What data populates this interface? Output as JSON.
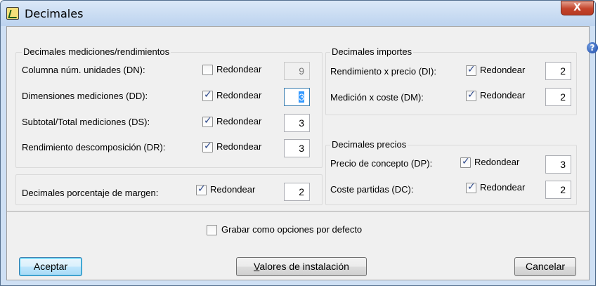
{
  "window": {
    "title": "Decimales",
    "close_label": "X"
  },
  "mediciones": {
    "title": "Decimales mediciones/rendimientos",
    "rows": [
      {
        "label": "Columna núm. unidades (DN):",
        "checkbox_label": "Redondear",
        "checked": false,
        "value": "9"
      },
      {
        "label": "Dimensiones mediciones (DD):",
        "checkbox_label": "Redondear",
        "checked": true,
        "value": "3"
      },
      {
        "label": "Subtotal/Total mediciones (DS):",
        "checkbox_label": "Redondear",
        "checked": true,
        "value": "3"
      },
      {
        "label": "Rendimiento descomposición (DR):",
        "checkbox_label": "Redondear",
        "checked": true,
        "value": "3"
      }
    ]
  },
  "margen": {
    "label": "Decimales porcentaje de margen:",
    "checkbox_label": "Redondear",
    "checked": true,
    "value": "2"
  },
  "importes": {
    "title": "Decimales importes",
    "rows": [
      {
        "label": "Rendimiento x precio (DI):",
        "checkbox_label": "Redondear",
        "checked": true,
        "value": "2"
      },
      {
        "label": "Medición x coste (DM):",
        "checkbox_label": "Redondear",
        "checked": true,
        "value": "2"
      }
    ]
  },
  "precios": {
    "title": "Decimales precios",
    "rows": [
      {
        "label": "Precio de concepto (DP):",
        "checkbox_label": "Redondear",
        "checked": true,
        "value": "3"
      },
      {
        "label": "Coste partidas (DC):",
        "checkbox_label": "Redondear",
        "checked": true,
        "value": "2"
      }
    ]
  },
  "defaults": {
    "label": "Grabar como opciones por defecto",
    "checked": false
  },
  "buttons": {
    "accept": "Aceptar",
    "install_accel": "V",
    "install_rest": "alores de instalación",
    "cancel": "Cancelar"
  },
  "icons": {
    "app": "app-logo-icon",
    "help": "help-icon",
    "close": "close-icon"
  }
}
